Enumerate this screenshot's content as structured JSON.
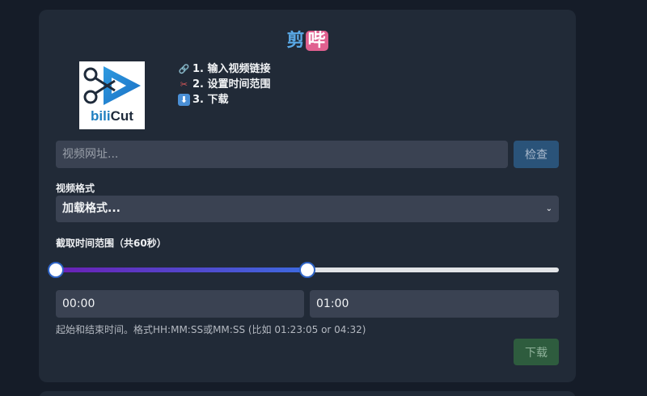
{
  "header": {
    "title_part1": "剪",
    "title_part2": "哔"
  },
  "logo": {
    "text_part1": "bili",
    "text_part2": "Cut"
  },
  "steps": [
    {
      "icon": "link-icon",
      "label": "1. 输入视频链接"
    },
    {
      "icon": "scissors-icon",
      "label": "2. 设置时间范围"
    },
    {
      "icon": "down-arrow-icon",
      "label": "3. 下载"
    }
  ],
  "url": {
    "placeholder": "视频网址...",
    "value": "",
    "check_label": "检查"
  },
  "format": {
    "label": "视频格式",
    "selected": "加载格式..."
  },
  "range": {
    "label": "截取时间范围（共60秒）",
    "start_fraction": 0,
    "end_fraction": 0.5,
    "start_value": "00:00",
    "end_value": "01:00",
    "hint": "起始和结束时间。格式HH:MM:SS或MM:SS (比如 01:23:05 or 04:32)"
  },
  "actions": {
    "download_label": "下载"
  },
  "colors": {
    "background": "#151c28",
    "card": "#212a37",
    "accent_blue": "#2f64c6",
    "check_button": "#2a5379",
    "download_button": "#2e5c3e",
    "title_badge": "#e0608f"
  }
}
